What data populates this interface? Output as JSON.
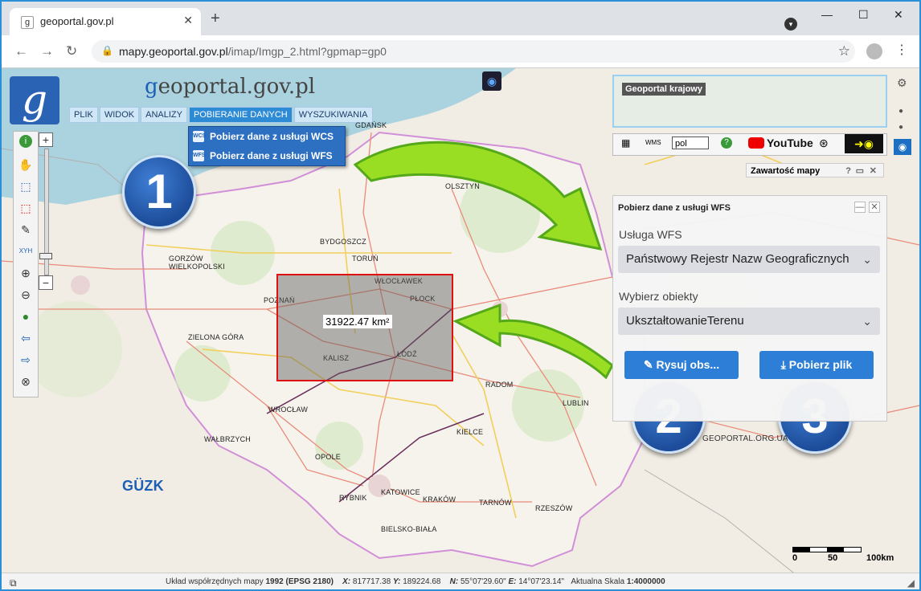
{
  "browser": {
    "tab_title": "geoportal.gov.pl",
    "tab_favicon": "g",
    "new_tab": "+",
    "url_host": "mapy.geoportal.gov.pl",
    "url_path": "/imap/Imgp_2.html?gpmap=gp0"
  },
  "app": {
    "logo_letter": "g",
    "title_g": "g",
    "title_rest": "eoportal.gov.pl",
    "menu": [
      "PLIK",
      "WIDOK",
      "ANALIZY",
      "POBIERANIE DANYCH",
      "WYSZUKIWANIA"
    ],
    "active_menu": "POBIERANIE DANYCH",
    "dropdown": [
      {
        "label": "Pobierz dane z usługi WCS",
        "icon": "wcs-icon",
        "icon_text": "WCS"
      },
      {
        "label": "Pobierz dane z usługi WFS",
        "icon": "wfs-icon",
        "icon_text": "WFS"
      }
    ]
  },
  "map": {
    "area_label": "31922.47 km²",
    "overview_label": "Geoportal krajowy",
    "language": "pol",
    "youtube_label": "YouTube",
    "map_contents_label": "Zawartość mapy",
    "watermark": "GEOPORTAL.ORG.UA",
    "guzk": "GÜZK",
    "cities": [
      "GDAŃSK",
      "OLSZTYN",
      "BYDGOSZCZ",
      "TORUŃ",
      "GORZÓW WIELKOPOLSKI",
      "WŁOCŁAWEK",
      "PŁOCK",
      "POZNAŃ",
      "ZIELONA GÓRA",
      "KALISZ",
      "ŁÓDŹ",
      "RADOM",
      "LUBLIN",
      "WROCŁAW",
      "KIELCE",
      "WAŁBRZYCH",
      "OPOLE",
      "KATOWICE",
      "RYBNIK",
      "KRAKÓW",
      "TARNÓW",
      "RZESZÓW",
      "BIELSKO-BIAŁA"
    ],
    "scale_labels": [
      "0",
      "50",
      "100km"
    ]
  },
  "wfs_panel": {
    "title": "Pobierz dane z usługi WFS",
    "service_label": "Usługa WFS",
    "service_value": "Państwowy Rejestr Nazw Geograficznych",
    "objects_label": "Wybierz obiekty",
    "objects_value": "UkształtowanieTerenu",
    "draw_button": "Rysuj obs...",
    "download_button": "Pobierz plik"
  },
  "badges": [
    "1",
    "2",
    "3"
  ],
  "status": {
    "crs_label": "Układ współrzędnych mapy",
    "crs_value": "1992 (EPSG 2180)",
    "x_label": "X:",
    "x_value": "817717.38",
    "y_label": "Y:",
    "y_value": "189224.68",
    "n_label": "N:",
    "n_value": "55°07'29.60\"",
    "e_label": "E:",
    "e_value": "14°07'23.14\"",
    "scale_label": "Aktualna Skala",
    "scale_value": "1:4000000"
  },
  "colors": {
    "menu_active": "#2d8ad4",
    "button_blue": "#2c7ed6",
    "selection_border": "#e01010",
    "badge_blue": "#1d4d9a",
    "arrow_green": "#8fd61a"
  }
}
